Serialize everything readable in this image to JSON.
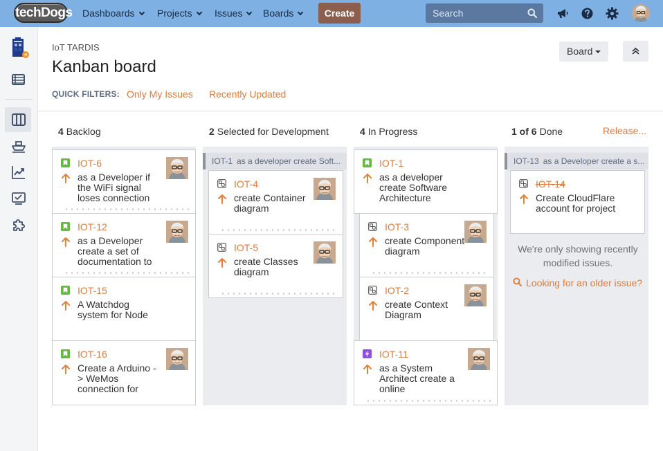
{
  "nav": {
    "logo": "techDogs",
    "items": [
      {
        "label": "Dashboards"
      },
      {
        "label": "Projects"
      },
      {
        "label": "Issues"
      },
      {
        "label": "Boards"
      }
    ],
    "create_label": "Create",
    "search_placeholder": "Search"
  },
  "header": {
    "breadcrumb": "IoT TARDIS",
    "title": "Kanban board",
    "board_button": "Board",
    "quick_filters_label": "QUICK FILTERS:",
    "quick_filters": [
      "Only My Issues",
      "Recently Updated"
    ]
  },
  "columns": [
    {
      "count": "4",
      "name": "Backlog"
    },
    {
      "count": "2",
      "name": "Selected for Development"
    },
    {
      "count": "4",
      "name": "In Progress"
    },
    {
      "count": "1 of 6",
      "name": "Done",
      "release_link": "Release..."
    }
  ],
  "cards": {
    "iot6": {
      "key": "IOT-6",
      "summary": "as a Developer if the WiFi signal loses connection"
    },
    "iot12": {
      "key": "IOT-12",
      "summary": "as a Developer create a set of documentation to"
    },
    "iot15": {
      "key": "IOT-15",
      "summary": "A Watchdog system for Node"
    },
    "iot16": {
      "key": "IOT-16",
      "summary": "Create a Arduino - > WeMos connection for"
    },
    "iot4": {
      "key": "IOT-4",
      "summary": "create Container diagram"
    },
    "iot5": {
      "key": "IOT-5",
      "summary": "create Classes diagram"
    },
    "iot1": {
      "key": "IOT-1",
      "summary": "as a developer create Software Architecture"
    },
    "iot3": {
      "key": "IOT-3",
      "summary": "create Component diagram"
    },
    "iot2": {
      "key": "IOT-2",
      "summary": "create Context Diagram"
    },
    "iot11": {
      "key": "IOT-11",
      "summary": "as a System Architect create a online"
    },
    "iot14": {
      "key": "IOT-14",
      "summary": "Create CloudFlare account for project"
    }
  },
  "parents": {
    "selected": {
      "key": "IOT-1",
      "summary": "as a developer create Soft..."
    },
    "done": {
      "key": "IOT-13",
      "summary": "as a Developer create a s..."
    }
  },
  "done_note": "We're only showing recently modified issues.",
  "older_link": "Looking for an older issue?",
  "colors": {
    "nav_bg": "#7eb0e4",
    "accent": "#e07b39",
    "create_btn": "#8b5e4d",
    "story_type": "#63ba3c",
    "epic_type": "#904ee2",
    "priority_arrow": "#e97f33"
  }
}
